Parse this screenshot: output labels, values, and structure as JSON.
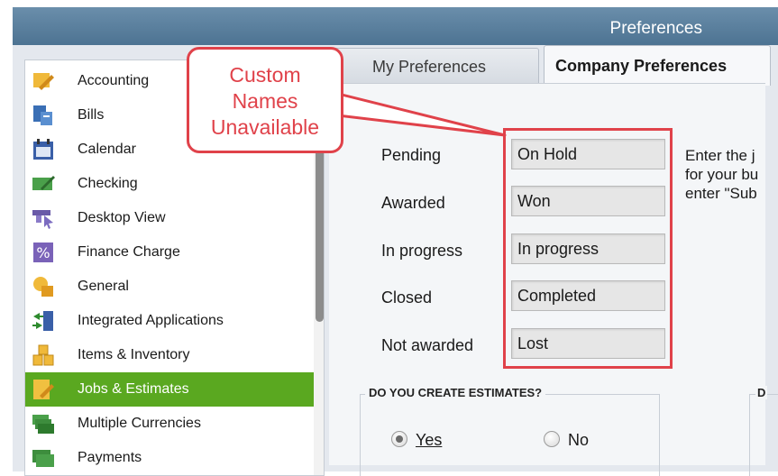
{
  "window": {
    "title": "Preferences"
  },
  "sidebar": {
    "items": [
      {
        "label": "Accounting",
        "icon": "accounting-icon"
      },
      {
        "label": "Bills",
        "icon": "bills-icon"
      },
      {
        "label": "Calendar",
        "icon": "calendar-icon"
      },
      {
        "label": "Checking",
        "icon": "checking-icon"
      },
      {
        "label": "Desktop View",
        "icon": "desktop-view-icon"
      },
      {
        "label": "Finance Charge",
        "icon": "finance-charge-icon"
      },
      {
        "label": "General",
        "icon": "general-icon"
      },
      {
        "label": "Integrated Applications",
        "icon": "integrated-applications-icon"
      },
      {
        "label": "Items & Inventory",
        "icon": "items-inventory-icon"
      },
      {
        "label": "Jobs & Estimates",
        "icon": "jobs-estimates-icon",
        "selected": true
      },
      {
        "label": "Multiple Currencies",
        "icon": "multiple-currencies-icon"
      },
      {
        "label": "Payments",
        "icon": "payments-icon"
      }
    ]
  },
  "tabs": {
    "my": "My Preferences",
    "company": "Company Preferences",
    "active": "company"
  },
  "job_status": {
    "rows": [
      {
        "label": "Pending",
        "value": "On Hold"
      },
      {
        "label": "Awarded",
        "value": "Won"
      },
      {
        "label": "In progress",
        "value": "In progress"
      },
      {
        "label": "Closed",
        "value": "Completed"
      },
      {
        "label": "Not awarded",
        "value": "Lost"
      }
    ],
    "description_lines": [
      "Enter the j",
      "for your bu",
      "enter \"Sub"
    ]
  },
  "estimates": {
    "title": "DO YOU CREATE ESTIMATES?",
    "yes_label": "Yes",
    "no_label": "No",
    "selected": "Yes"
  },
  "right_group": {
    "title": "D"
  },
  "annotation": {
    "text": "Custom Names Unavailable",
    "lines": [
      "Custom",
      "Names",
      "Unavailable"
    ],
    "color": "#e0424a"
  },
  "colors": {
    "selected_item": "#5aa820",
    "titlebar": "#5b809e"
  }
}
